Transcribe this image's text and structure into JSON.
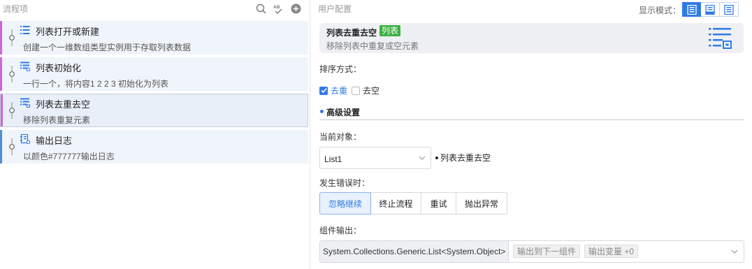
{
  "left": {
    "title": "流程项",
    "icons": [
      "search-icon",
      "spell-check-icon",
      "add-circle-icon"
    ],
    "steps": [
      {
        "title": "列表打开或新建",
        "desc": "创建一个一维数组类型实例用于存取列表数据",
        "icon": "list-icon",
        "color": "#cc66dd",
        "selected": false
      },
      {
        "title": "列表初始化",
        "desc": "一行一个，将内容1 2 2 3 初始化为列表",
        "icon": "list-init-icon",
        "color": "#cc66dd",
        "selected": false
      },
      {
        "title": "列表去重去空",
        "desc": "移除列表重复元素",
        "icon": "list-dedup-icon",
        "color": "#cc66dd",
        "selected": true
      },
      {
        "title": "输出日志",
        "desc": "以颜色#777777输出日志",
        "icon": "log-icon",
        "color": "#4a90d9",
        "selected": false
      }
    ]
  },
  "right": {
    "title": "用户配置",
    "display_mode_label": "显示模式：",
    "display_modes": [
      "mode-full-icon",
      "mode-compact-icon",
      "mode-list-icon"
    ],
    "card": {
      "title": "列表去重去空",
      "tag": "列表",
      "desc": "移除列表中重复或空元素",
      "icon": "list-config-icon"
    },
    "sort_label": "排序方式：",
    "options": [
      {
        "label": "去重",
        "checked": true
      },
      {
        "label": "去空",
        "checked": false
      }
    ],
    "advanced_title": "高级设置",
    "current_object_label": "当前对象：",
    "current_object_value": "List1",
    "current_object_note": "列表去重去空",
    "on_error_label": "发生错误时：",
    "error_actions": [
      {
        "label": "忽略继续",
        "active": true
      },
      {
        "label": "终止流程",
        "active": false
      },
      {
        "label": "重试",
        "active": false
      },
      {
        "label": "抛出异常",
        "active": false
      }
    ],
    "output_label": "组件输出：",
    "output_type": "System.Collections.Generic.List<System.Object>",
    "output_next": "输出到下一组件",
    "output_var": "输出变量 +0"
  },
  "colors": {
    "accent": "#2f7be5",
    "tag_green": "#3cb043",
    "list_bar": "#cc66dd",
    "log_bar": "#4a90d9"
  }
}
